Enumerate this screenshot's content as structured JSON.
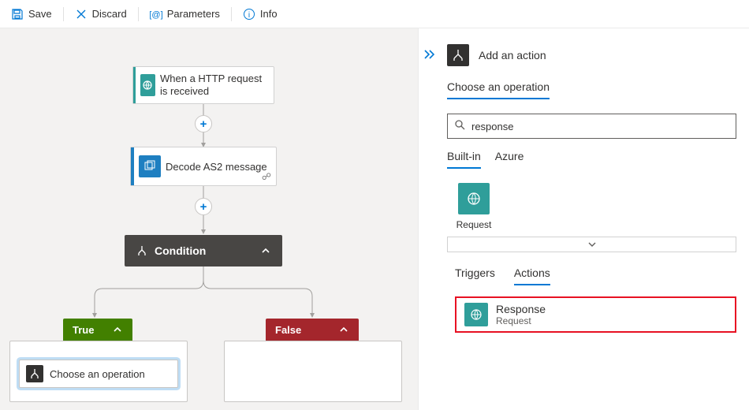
{
  "toolbar": {
    "save": "Save",
    "discard": "Discard",
    "parameters": "Parameters",
    "info": "Info"
  },
  "workflow": {
    "trigger_label": "When a HTTP request is received",
    "step2_label": "Decode AS2 message",
    "condition_label": "Condition",
    "true_label": "True",
    "false_label": "False",
    "choose_op_label": "Choose an operation"
  },
  "panel": {
    "header_title": "Add an action",
    "choose_label": "Choose an operation",
    "search_value": "response",
    "svc_tabs": {
      "builtin": "Built-in",
      "azure": "Azure"
    },
    "service_tile": "Request",
    "trig_tabs": {
      "triggers": "Triggers",
      "actions": "Actions"
    },
    "result": {
      "title": "Response",
      "sub": "Request"
    }
  }
}
